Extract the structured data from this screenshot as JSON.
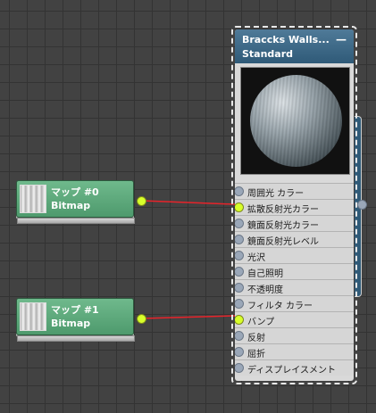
{
  "map_nodes": [
    {
      "title": "マップ #0",
      "type": "Bitmap",
      "thumb_icon": "bitmap-thumbnail-icon"
    },
    {
      "title": "マップ #1",
      "type": "Bitmap",
      "thumb_icon": "bitmap-thumbnail-icon"
    }
  ],
  "material": {
    "title": "Braccks Walls...",
    "type": "Standard",
    "minimize_icon": "—",
    "slots": [
      {
        "label": "周囲光 カラー",
        "connected": false
      },
      {
        "label": "拡散反射光カラー",
        "connected": true
      },
      {
        "label": "鏡面反射光カラー",
        "connected": false
      },
      {
        "label": "鏡面反射光レベル",
        "connected": false
      },
      {
        "label": "光沢",
        "connected": false
      },
      {
        "label": "自己照明",
        "connected": false
      },
      {
        "label": "不透明度",
        "connected": false
      },
      {
        "label": "フィルタ カラー",
        "connected": false
      },
      {
        "label": "バンプ",
        "connected": true
      },
      {
        "label": "反射",
        "connected": false
      },
      {
        "label": "屈折",
        "connected": false
      },
      {
        "label": "ディスプレイスメント",
        "connected": false
      }
    ]
  },
  "colors": {
    "wire": "#e8232a",
    "socket_active": "#d8ff2a",
    "map_node": "#5aa77a",
    "material_header": "#3c6a8b"
  }
}
